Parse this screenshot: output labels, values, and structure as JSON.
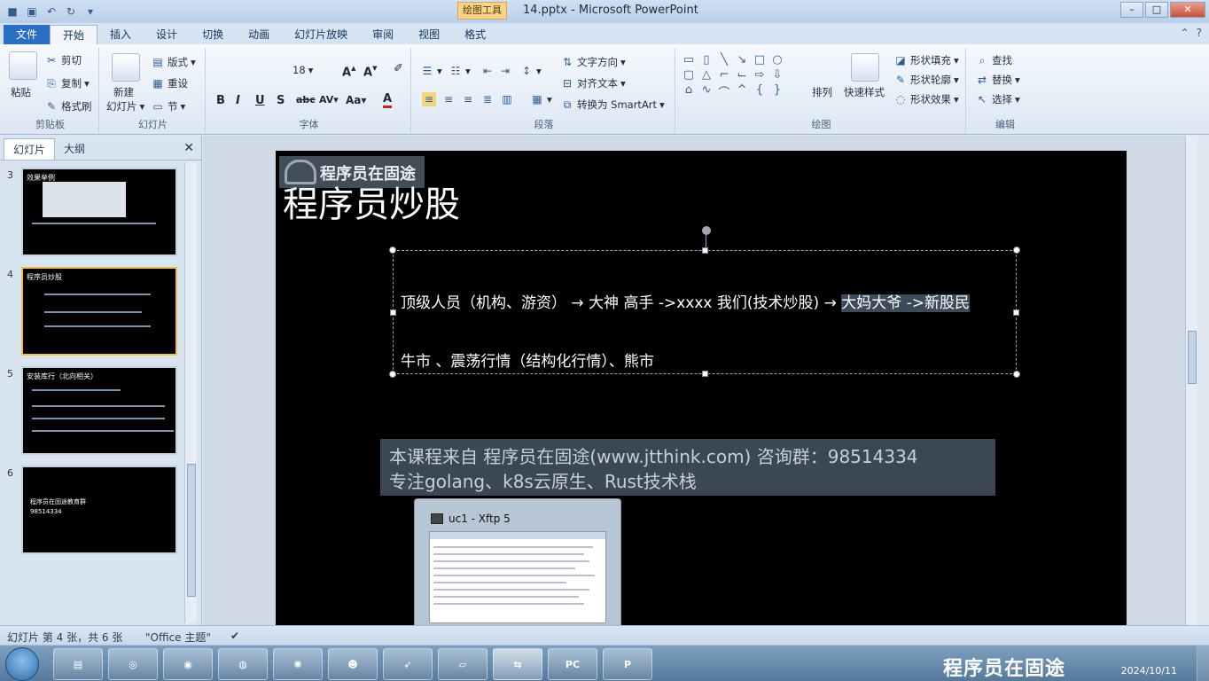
{
  "window": {
    "title": "14.pptx - Microsoft PowerPoint",
    "contextual_tab": "绘图工具"
  },
  "ribbon_tabs": [
    "文件",
    "开始",
    "插入",
    "设计",
    "切换",
    "动画",
    "幻灯片放映",
    "审阅",
    "视图",
    "格式"
  ],
  "ribbon": {
    "clipboard": {
      "paste": "粘贴",
      "cut": "剪切",
      "copy": "复制",
      "format_painter": "格式刷",
      "label": "剪贴板"
    },
    "slides": {
      "new_slide": "新建",
      "new_slide_2": "幻灯片",
      "layout": "版式",
      "reset": "重设",
      "section": "节",
      "label": "幻灯片"
    },
    "font": {
      "size": "18",
      "label": "字体"
    },
    "paragraph": {
      "text_direction": "文字方向",
      "align_text": "对齐文本",
      "smartart": "转换为 SmartArt",
      "label": "段落"
    },
    "drawing": {
      "arrange": "排列",
      "quick_styles": "快速样式",
      "shape_fill": "形状填充",
      "shape_outline": "形状轮廓",
      "shape_effects": "形状效果",
      "label": "绘图"
    },
    "editing": {
      "find": "查找",
      "replace": "替换",
      "select": "选择",
      "label": "编辑"
    }
  },
  "panel": {
    "tabs": [
      "幻灯片",
      "大纲"
    ],
    "thumbnails": [
      {
        "num": "3",
        "title": "效果举例"
      },
      {
        "num": "4",
        "title": "程序员炒股"
      },
      {
        "num": "5",
        "title": "安装库行（北向相关）"
      },
      {
        "num": "6",
        "line1": "程序员在固途教育群",
        "line2": "98514334"
      }
    ]
  },
  "slide": {
    "logo_text": "程序员在固途",
    "title": "程序员炒股",
    "line1_prefix": "顶级人员（机构、游资）",
    "line1_mid": "大神 高手 ->xxxx   我们(技术炒股)",
    "line1_highlight": "大妈大爷  ->新股民",
    "arrow": "→",
    "line2": "牛市 、震荡行情（结构化行情）、熊市",
    "footer_line1": "本课程来自 程序员在固途(www.jtthink.com) 咨询群：98514334",
    "footer_line2": "专注golang、k8s云原生、Rust技术栈"
  },
  "preview": {
    "title": "uc1    - Xftp 5"
  },
  "statusbar": {
    "slide_info": "幻灯片 第 4 张，共 6 张",
    "theme": "\"Office 主题\""
  },
  "taskbar": {
    "watermark": "程序员在固途",
    "date": "2024/10/11"
  }
}
